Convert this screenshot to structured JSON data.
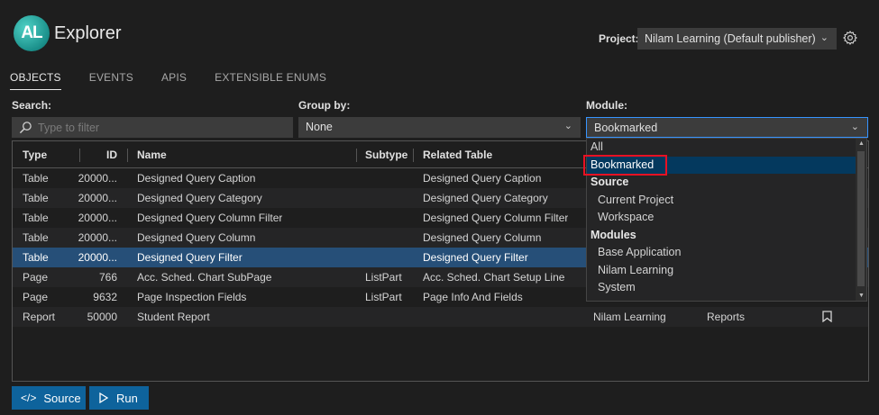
{
  "app": {
    "logo_text": "AL",
    "title": "Explorer"
  },
  "project": {
    "label": "Project:",
    "value": "Nilam Learning (Default publisher)"
  },
  "tabs": [
    {
      "label": "OBJECTS",
      "active": true
    },
    {
      "label": "EVENTS",
      "active": false
    },
    {
      "label": "APIS",
      "active": false
    },
    {
      "label": "EXTENSIBLE ENUMS",
      "active": false
    }
  ],
  "filters": {
    "search_label": "Search:",
    "search_placeholder": "Type to filter",
    "groupby_label": "Group by:",
    "groupby_value": "None",
    "module_label": "Module:",
    "module_value": "Bookmarked"
  },
  "table": {
    "columns": [
      "Type",
      "ID",
      "Name",
      "Subtype",
      "Related Table"
    ],
    "rows": [
      {
        "type": "Table",
        "id": "20000...",
        "name": "Designed Query Caption",
        "subtype": "",
        "related": "Designed Query Caption",
        "module": "",
        "category": ""
      },
      {
        "type": "Table",
        "id": "20000...",
        "name": "Designed Query Category",
        "subtype": "",
        "related": "Designed Query Category",
        "module": "",
        "category": ""
      },
      {
        "type": "Table",
        "id": "20000...",
        "name": "Designed Query Column Filter",
        "subtype": "",
        "related": "Designed Query Column Filter",
        "module": "",
        "category": ""
      },
      {
        "type": "Table",
        "id": "20000...",
        "name": "Designed Query Column",
        "subtype": "",
        "related": "Designed Query Column",
        "module": "",
        "category": ""
      },
      {
        "type": "Table",
        "id": "20000...",
        "name": "Designed Query Filter",
        "subtype": "",
        "related": "Designed Query Filter",
        "module": "",
        "category": ""
      },
      {
        "type": "Page",
        "id": "766",
        "name": "Acc. Sched. Chart SubPage",
        "subtype": "ListPart",
        "related": "Acc. Sched. Chart Setup Line",
        "module": "",
        "category": ""
      },
      {
        "type": "Page",
        "id": "9632",
        "name": "Page Inspection Fields",
        "subtype": "ListPart",
        "related": "Page Info And Fields",
        "module": "",
        "category": ""
      },
      {
        "type": "Report",
        "id": "50000",
        "name": "Student Report",
        "subtype": "",
        "related": "",
        "module": "Nilam Learning",
        "category": "Reports"
      }
    ]
  },
  "dropdown": {
    "items": [
      {
        "label": "All",
        "kind": "item"
      },
      {
        "label": "Bookmarked",
        "kind": "item"
      },
      {
        "label": "Source",
        "kind": "group"
      },
      {
        "label": "Current Project",
        "kind": "sub"
      },
      {
        "label": "Workspace",
        "kind": "sub"
      },
      {
        "label": "Modules",
        "kind": "group"
      },
      {
        "label": "Base Application",
        "kind": "sub"
      },
      {
        "label": "Nilam Learning",
        "kind": "sub"
      },
      {
        "label": "System",
        "kind": "sub"
      }
    ]
  },
  "buttons": {
    "source_label": "Source",
    "run_label": "Run"
  },
  "colors": {
    "accent": "#0e639c",
    "selection": "#264f78",
    "highlight_border": "#e81123"
  }
}
